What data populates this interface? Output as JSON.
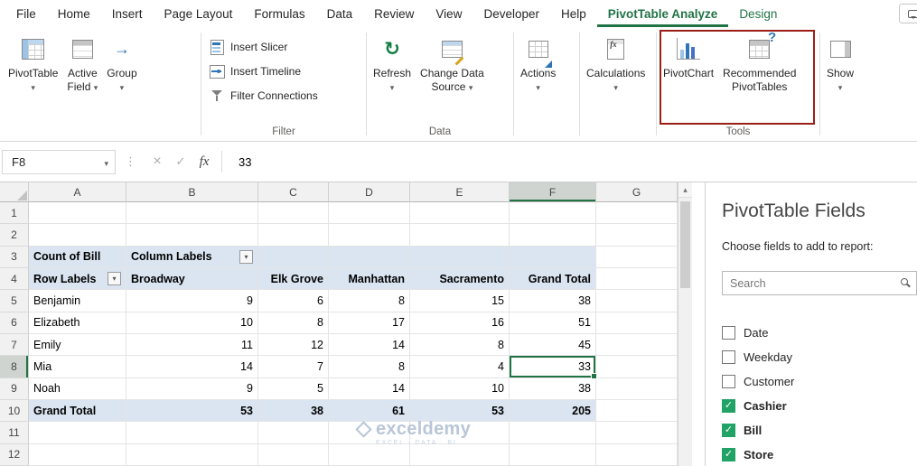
{
  "colors": {
    "accent_green": "#217346",
    "annotation_red": "#9b1f17",
    "pivot_shade_blue": "#dbe5f1",
    "checkbox_green": "#21a366"
  },
  "ribbon": {
    "tabs": [
      {
        "label": "File"
      },
      {
        "label": "Home"
      },
      {
        "label": "Insert"
      },
      {
        "label": "Page Layout"
      },
      {
        "label": "Formulas"
      },
      {
        "label": "Data"
      },
      {
        "label": "Review"
      },
      {
        "label": "View"
      },
      {
        "label": "Developer"
      },
      {
        "label": "Help"
      },
      {
        "label": "PivotTable Analyze",
        "active": true
      },
      {
        "label": "Design",
        "accent": true
      }
    ],
    "buttons": {
      "pivottable": "PivotTable",
      "active_field_line1": "Active",
      "active_field_line2": "Field",
      "group": "Group",
      "insert_slicer": "Insert Slicer",
      "insert_timeline": "Insert Timeline",
      "filter_connections": "Filter Connections",
      "refresh": "Refresh",
      "change_data_line1": "Change Data",
      "change_data_line2": "Source",
      "actions": "Actions",
      "calculations": "Calculations",
      "pivotchart": "PivotChart",
      "recommended_line1": "Recommended",
      "recommended_line2": "PivotTables",
      "show": "Show"
    },
    "group_labels": {
      "filter": "Filter",
      "data": "Data",
      "tools": "Tools"
    }
  },
  "formula_bar": {
    "name_box": "F8",
    "value": "33"
  },
  "sheet": {
    "columns": [
      "A",
      "B",
      "C",
      "D",
      "E",
      "F",
      "G"
    ],
    "selected": {
      "ref": "F8",
      "column": "F",
      "row": 8
    },
    "rows": [
      {
        "n": 1,
        "cells": [
          null,
          null,
          null,
          null,
          null,
          null,
          null
        ]
      },
      {
        "n": 2,
        "cells": [
          null,
          null,
          null,
          null,
          null,
          null,
          null
        ]
      },
      {
        "n": 3,
        "cells": [
          {
            "t": "Count of Bill",
            "b": 1,
            "s": 1
          },
          {
            "t": "Column Labels",
            "b": 1,
            "s": 1,
            "dd": 1
          },
          {
            "s": 1
          },
          {
            "s": 1
          },
          {
            "s": 1
          },
          {
            "s": 1
          },
          null
        ]
      },
      {
        "n": 4,
        "cells": [
          {
            "t": "Row Labels",
            "b": 1,
            "s": 1,
            "dd": 1
          },
          {
            "t": "Broadway",
            "b": 1,
            "s": 1
          },
          {
            "t": "Elk Grove",
            "b": 1,
            "s": 1,
            "a": "r"
          },
          {
            "t": "Manhattan",
            "b": 1,
            "s": 1,
            "a": "r"
          },
          {
            "t": "Sacramento",
            "b": 1,
            "s": 1,
            "a": "r"
          },
          {
            "t": "Grand Total",
            "b": 1,
            "s": 1,
            "a": "r"
          },
          null
        ]
      },
      {
        "n": 5,
        "cells": [
          {
            "t": "Benjamin"
          },
          {
            "t": "9",
            "a": "r"
          },
          {
            "t": "6",
            "a": "r"
          },
          {
            "t": "8",
            "a": "r"
          },
          {
            "t": "15",
            "a": "r"
          },
          {
            "t": "38",
            "a": "r"
          },
          null
        ]
      },
      {
        "n": 6,
        "cells": [
          {
            "t": "Elizabeth"
          },
          {
            "t": "10",
            "a": "r"
          },
          {
            "t": "8",
            "a": "r"
          },
          {
            "t": "17",
            "a": "r"
          },
          {
            "t": "16",
            "a": "r"
          },
          {
            "t": "51",
            "a": "r"
          },
          null
        ]
      },
      {
        "n": 7,
        "cells": [
          {
            "t": "Emily"
          },
          {
            "t": "11",
            "a": "r"
          },
          {
            "t": "12",
            "a": "r"
          },
          {
            "t": "14",
            "a": "r"
          },
          {
            "t": "8",
            "a": "r"
          },
          {
            "t": "45",
            "a": "r"
          },
          null
        ]
      },
      {
        "n": 8,
        "cells": [
          {
            "t": "Mia"
          },
          {
            "t": "14",
            "a": "r"
          },
          {
            "t": "7",
            "a": "r"
          },
          {
            "t": "8",
            "a": "r"
          },
          {
            "t": "4",
            "a": "r"
          },
          {
            "t": "33",
            "a": "r",
            "sel": 1
          },
          null
        ]
      },
      {
        "n": 9,
        "cells": [
          {
            "t": "Noah"
          },
          {
            "t": "9",
            "a": "r"
          },
          {
            "t": "5",
            "a": "r"
          },
          {
            "t": "14",
            "a": "r"
          },
          {
            "t": "10",
            "a": "r"
          },
          {
            "t": "38",
            "a": "r"
          },
          null
        ]
      },
      {
        "n": 10,
        "cells": [
          {
            "t": "Grand Total",
            "b": 1,
            "s": 1
          },
          {
            "t": "53",
            "b": 1,
            "s": 1,
            "a": "r"
          },
          {
            "t": "38",
            "b": 1,
            "s": 1,
            "a": "r"
          },
          {
            "t": "61",
            "b": 1,
            "s": 1,
            "a": "r"
          },
          {
            "t": "53",
            "b": 1,
            "s": 1,
            "a": "r"
          },
          {
            "t": "205",
            "b": 1,
            "s": 1,
            "a": "r"
          },
          null
        ]
      },
      {
        "n": 11,
        "cells": [
          null,
          null,
          null,
          null,
          null,
          null,
          null
        ]
      },
      {
        "n": 12,
        "cells": [
          null,
          null,
          null,
          null,
          null,
          null,
          null
        ]
      }
    ]
  },
  "watermark": {
    "brand": "exceldemy",
    "tagline": "EXCEL · DATA · BI"
  },
  "fields_panel": {
    "title": "PivotTable Fields",
    "subtitle": "Choose fields to add to report:",
    "search_placeholder": "Search",
    "fields": [
      {
        "label": "Date",
        "checked": false
      },
      {
        "label": "Weekday",
        "checked": false
      },
      {
        "label": "Customer",
        "checked": false
      },
      {
        "label": "Cashier",
        "checked": true
      },
      {
        "label": "Bill",
        "checked": true
      },
      {
        "label": "Store",
        "checked": true
      }
    ]
  }
}
